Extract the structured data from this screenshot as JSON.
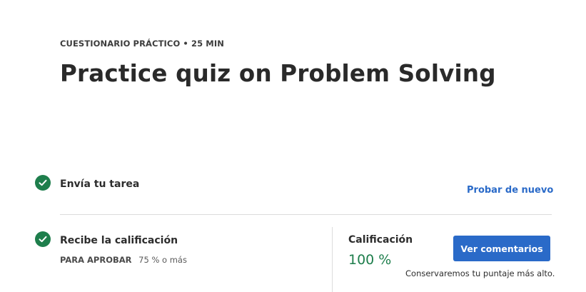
{
  "header": {
    "eyebrow": "CUESTIONARIO PRÁCTICO • 25 MIN",
    "title": "Practice quiz on Problem Solving"
  },
  "steps": [
    {
      "title": "Envía tu tarea",
      "icon": "check-circle-icon",
      "action_label": "Probar de nuevo"
    },
    {
      "title": "Recibe la calificación",
      "icon": "check-circle-icon"
    }
  ],
  "pass": {
    "label": "PARA APROBAR",
    "value": "75 % o más"
  },
  "grade": {
    "label": "Calificación",
    "value": "100 %",
    "feedback_button": "Ver comentarios",
    "note": "Conservaremos tu puntaje más alto."
  },
  "colors": {
    "success": "#1e7e4c",
    "accent": "#2a6ac8"
  }
}
